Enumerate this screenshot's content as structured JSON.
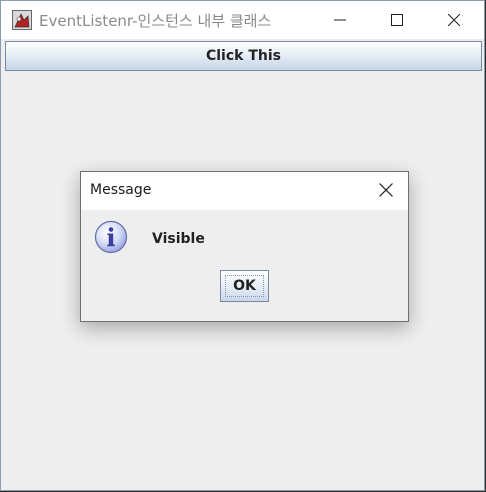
{
  "window": {
    "title": "EventListenr-인스턴스 내부 클래스"
  },
  "main": {
    "button_label": "Click This"
  },
  "dialog": {
    "title": "Message",
    "message": "Visible",
    "ok_label": "OK",
    "icon": "info-icon"
  },
  "colors": {
    "window_bg": "#eeeeee",
    "titlebar_bg": "#ffffff",
    "button_border": "#7a8aa3"
  }
}
